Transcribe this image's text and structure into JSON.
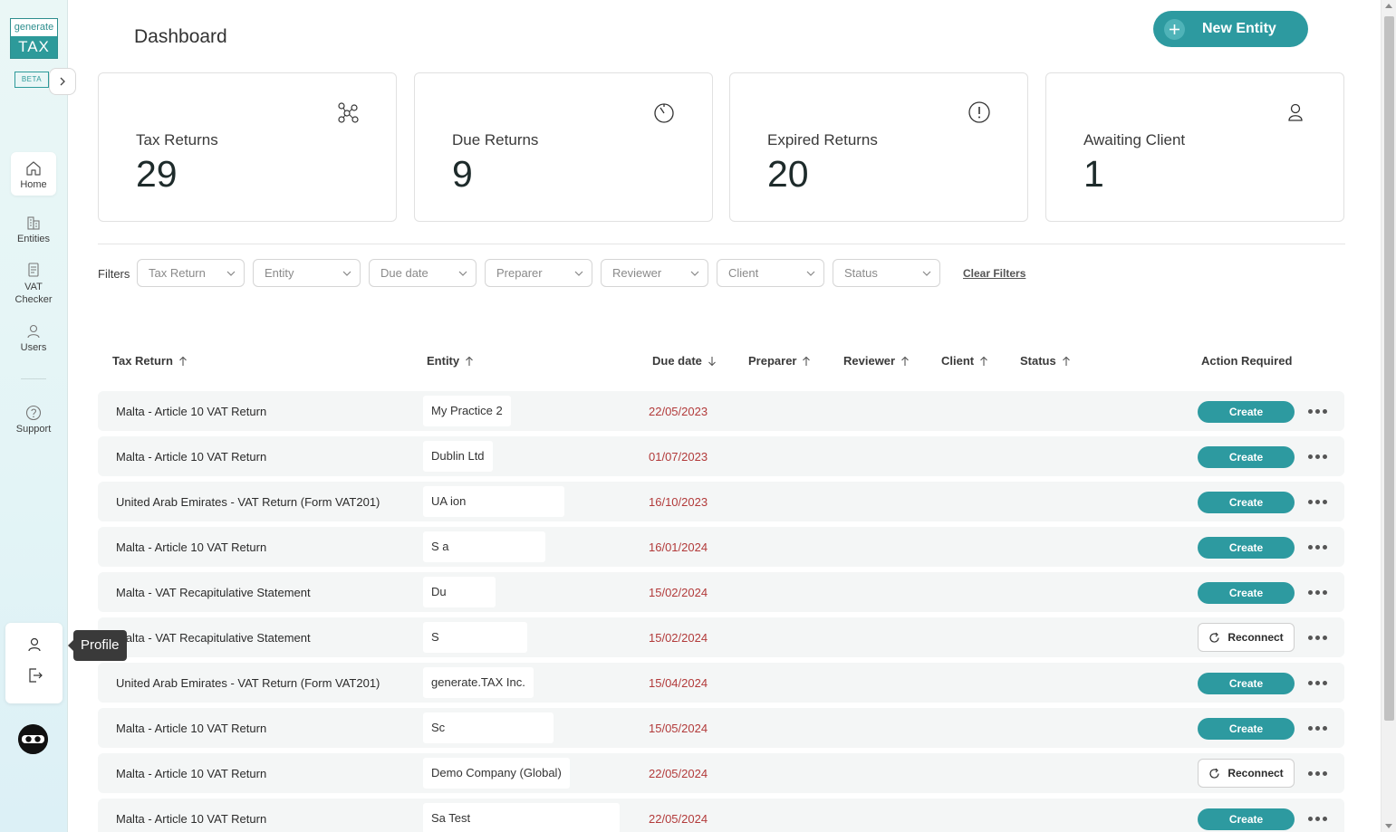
{
  "app": {
    "logo_top": "generate",
    "logo_bottom": "TAX",
    "beta": "BETA"
  },
  "sidebar": {
    "items": [
      {
        "label": "Home",
        "icon": "home-icon",
        "active": true
      },
      {
        "label": "Entities",
        "icon": "buildings-icon",
        "active": false
      },
      {
        "label": "VAT Checker",
        "icon": "document-icon",
        "active": false
      },
      {
        "label": "Users",
        "icon": "user-icon",
        "active": false
      },
      {
        "label": "Support",
        "icon": "question-circle-icon",
        "active": false
      }
    ],
    "profile_tooltip": "Profile"
  },
  "header": {
    "title": "Dashboard",
    "new_entity_label": "New Entity"
  },
  "stats": [
    {
      "label": "Tax Returns",
      "value": "29",
      "icon": "network-nodes-icon"
    },
    {
      "label": "Due Returns",
      "value": "9",
      "icon": "timer-icon"
    },
    {
      "label": "Expired Returns",
      "value": "20",
      "icon": "exclamation-circle-icon"
    },
    {
      "label": "Awaiting Client",
      "value": "1",
      "icon": "user-icon"
    }
  ],
  "filters": {
    "label": "Filters",
    "items": [
      "Tax Return",
      "Entity",
      "Due date",
      "Preparer",
      "Reviewer",
      "Client",
      "Status"
    ],
    "clear_label": "Clear Filters"
  },
  "table": {
    "columns": [
      {
        "label": "Tax Return",
        "sort": "up"
      },
      {
        "label": "Entity",
        "sort": "up"
      },
      {
        "label": "Due date",
        "sort": "down"
      },
      {
        "label": "Preparer",
        "sort": "up"
      },
      {
        "label": "Reviewer",
        "sort": "up"
      },
      {
        "label": "Client",
        "sort": "up"
      },
      {
        "label": "Status",
        "sort": "up"
      },
      {
        "label": "Action Required",
        "sort": ""
      }
    ],
    "rows": [
      {
        "tax_return": "Malta - Article 10 VAT Return",
        "entity": "My Practice 2",
        "due": "22/05/2023",
        "action": "Create"
      },
      {
        "tax_return": "Malta - Article 10 VAT Return",
        "entity": "Dublin Ltd",
        "due": "01/07/2023",
        "action": "Create"
      },
      {
        "tax_return": "United Arab Emirates - VAT Return (Form VAT201)",
        "entity": "UA                          ion",
        "due": "16/10/2023",
        "action": "Create"
      },
      {
        "tax_return": "Malta - Article 10 VAT Return",
        "entity": "S                         a",
        "due": "16/01/2024",
        "action": "Create"
      },
      {
        "tax_return": "Malta - VAT Recapitulative Statement",
        "entity": "Du",
        "due": "15/02/2024",
        "action": "Create"
      },
      {
        "tax_return": "Malta - VAT Recapitulative Statement",
        "entity": "S",
        "due": "15/02/2024",
        "action": "Reconnect"
      },
      {
        "tax_return": "United Arab Emirates - VAT Return (Form VAT201)",
        "entity": "generate.TAX Inc.",
        "due": "15/04/2024",
        "action": "Create"
      },
      {
        "tax_return": "Malta - Article 10 VAT Return",
        "entity": "Sc",
        "due": "15/05/2024",
        "action": "Create"
      },
      {
        "tax_return": "Malta - Article 10 VAT Return",
        "entity": "Demo Company (Global)",
        "due": "22/05/2024",
        "action": "Reconnect"
      },
      {
        "tax_return": "Malta - Article 10 VAT Return",
        "entity": "Sa                                    Test",
        "due": "22/05/2024",
        "action": "Create"
      }
    ]
  }
}
